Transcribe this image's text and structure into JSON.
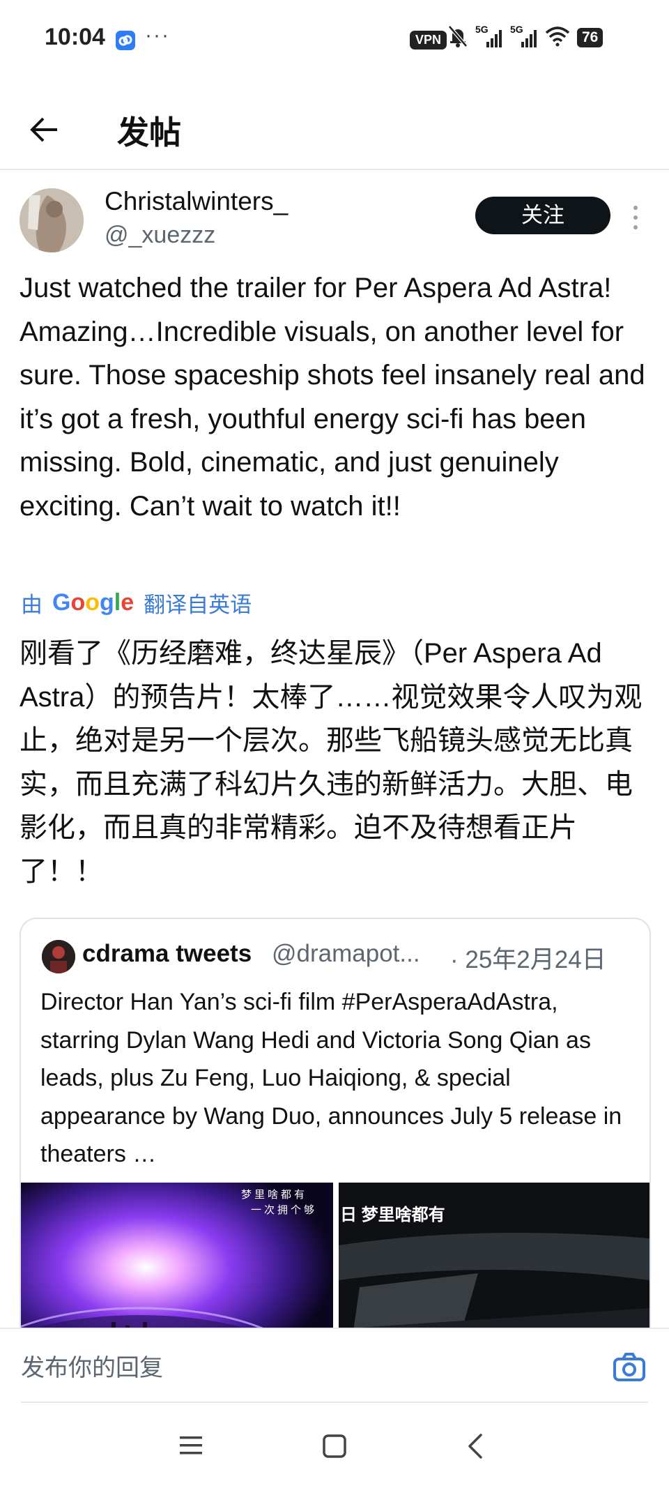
{
  "status_bar": {
    "time": "10:04",
    "more_dots": "···",
    "vpn": "VPN",
    "sim1": "5G",
    "sim2": "5G",
    "battery": "76"
  },
  "header": {
    "title": "发帖"
  },
  "post": {
    "display_name": "Christalwinters_",
    "handle": "@_xuezzz",
    "follow_label": "关注",
    "text": "Just watched the trailer for Per Aspera Ad Astra! Amazing…Incredible visuals, on another level for sure. Those spaceship shots feel insanely real and it’s got a fresh, youthful energy sci-fi has been missing. Bold, cinematic, and just genuinely exciting. Can’t wait to watch it!!",
    "translate_prefix": "由",
    "translate_brand": "Google",
    "translate_suffix": "翻译自英语",
    "text_translated": "刚看了《历经磨难，终达星辰》（Per Aspera Ad Astra）的预告片！太棒了……视觉效果令人叹为观止，绝对是另一个层次。那些飞船镜头感觉无比真实，而且充满了科幻片久违的新鲜活力。大胆、电影化，而且真的非常精彩。迫不及待想看正片了！！"
  },
  "quote": {
    "name": "cdrama tweets",
    "handle": "@dramapot...",
    "date": "· 25年2月24日",
    "text": "Director Han Yan’s sci-fi film #PerAsperaAdAstra, starring Dylan Wang Hedi and Victoria Song Qian as leads, plus Zu Feng, Luo Haiqiong, & special appearance by Wang Duo, announces July 5 release in theaters …",
    "image1_caption": "梦里啥都有",
    "image1_caption2": "一次拥个够",
    "image2_caption": "日  梦里啥都有"
  },
  "reply": {
    "placeholder": "发布你的回复"
  },
  "colors": {
    "accent": "#3a7bd5",
    "follow_bg": "#0f1419",
    "secondary_text": "#5b6670"
  }
}
